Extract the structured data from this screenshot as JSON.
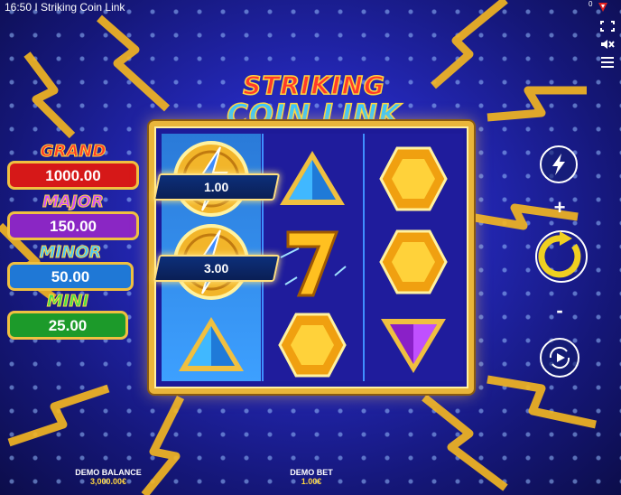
{
  "topbar": {
    "title": "16:50 I Striking Coin Link",
    "counter": "0"
  },
  "logo": {
    "line1": "STRIKING",
    "line2": "COIN LINK"
  },
  "jackpots": [
    {
      "name": "GRAND",
      "value": "1000.00",
      "name_color": "#ff3a2a",
      "box_color": "#d61818"
    },
    {
      "name": "MAJOR",
      "value": "150.00",
      "name_color": "#d04cff",
      "box_color": "#8a26c4"
    },
    {
      "name": "MINOR",
      "value": "50.00",
      "name_color": "#48c8ff",
      "box_color": "#1f78d6"
    },
    {
      "name": "MINI",
      "value": "25.00",
      "name_color": "#46e04a",
      "box_color": "#1c9a2a"
    }
  ],
  "reels": {
    "coin_values": [
      "1.00",
      "3.00"
    ],
    "symbols": [
      [
        "lightning-coin-icon",
        "lightning-coin-icon",
        "blue-triangle-gem-icon"
      ],
      [
        "blue-triangle-gem-icon",
        "lucky-seven-icon",
        "yellow-hexagon-gem-icon"
      ],
      [
        "yellow-hexagon-gem-icon",
        "yellow-hexagon-gem-icon",
        "purple-triangle-gem-icon"
      ]
    ]
  },
  "controls": {
    "plus": "+",
    "minus": "-"
  },
  "footer": {
    "balance_label": "DEMO BALANCE",
    "balance_value": "3,000.00€",
    "bet_label": "DEMO BET",
    "bet_value": "1.00€"
  },
  "colors": {
    "accent": "#ffd640",
    "frame": "#e9b53a",
    "bg": "#2428b8"
  }
}
